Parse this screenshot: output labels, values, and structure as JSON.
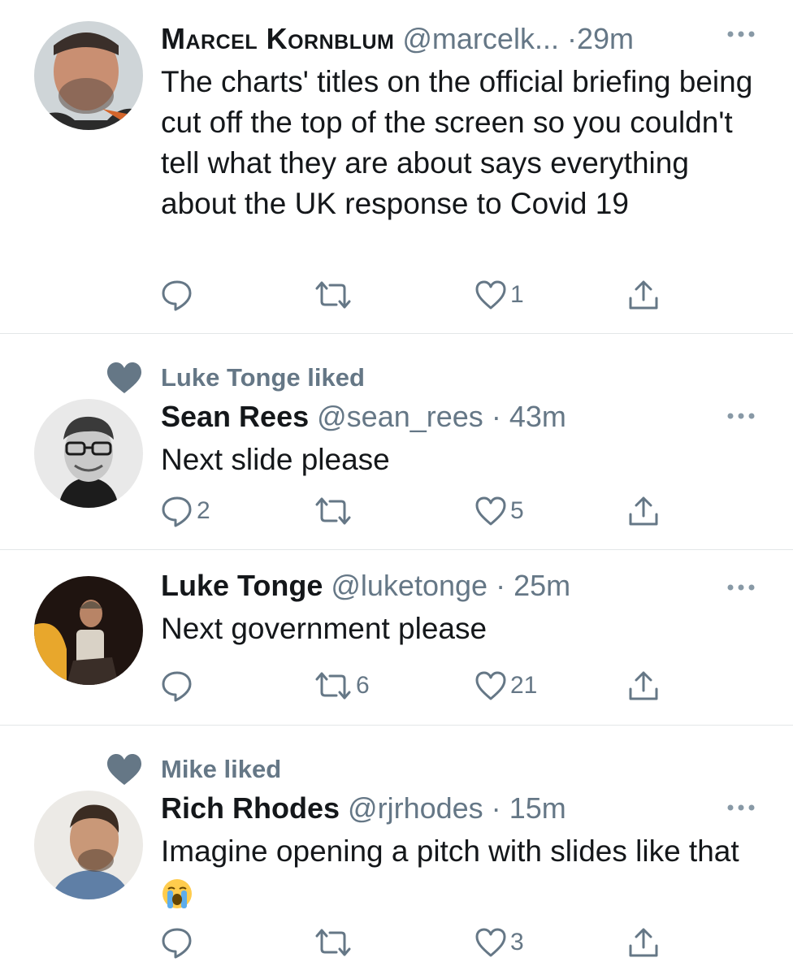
{
  "tweets": [
    {
      "liked_by": "",
      "name": "Marcel Kornblum",
      "handle": "@marcelk...",
      "separator": "·",
      "time": "29m",
      "text": "The charts' titles on the official briefing being cut off the top of the screen so you couldn't tell what they are about says everything about the UK response to Covid 19",
      "replies": "",
      "retweets": "",
      "likes": "1"
    },
    {
      "liked_by": "Luke Tonge liked",
      "name": "Sean Rees",
      "handle": "@sean_rees",
      "separator": "·",
      "time": "43m",
      "text": "Next slide please",
      "replies": "2",
      "retweets": "",
      "likes": "5"
    },
    {
      "liked_by": "",
      "name": "Luke Tonge",
      "handle": "@luketonge",
      "separator": "·",
      "time": "25m",
      "text": "Next government please",
      "replies": "",
      "retweets": "6",
      "likes": "21"
    },
    {
      "liked_by": "Mike liked",
      "name": "Rich Rhodes",
      "handle": "@rjrhodes",
      "separator": "·",
      "time": "15m",
      "text": "Imagine opening a pitch with slides like that",
      "replies": "",
      "retweets": "",
      "likes": "3"
    }
  ],
  "icons": {
    "reply": "reply-icon",
    "retweet": "retweet-icon",
    "like": "heart-outline-icon",
    "share": "share-icon",
    "more": "more-icon",
    "liked": "heart-filled-icon",
    "emoji": "loudly-crying-face-emoji"
  },
  "colors": {
    "text": "#14171a",
    "secondary": "#657786",
    "divider": "#e3e6e8"
  }
}
